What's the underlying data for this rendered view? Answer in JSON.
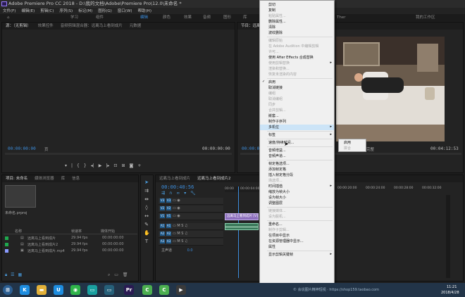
{
  "window": {
    "title": "Adobe Premiere Pro CC 2018 - D:\\我的文档\\Adobe\\Premiere Pro\\12.0\\未命名 *"
  },
  "menubar": [
    "文件(F)",
    "编辑(E)",
    "剪辑(C)",
    "序列(S)",
    "标记(M)",
    "图形(G)",
    "窗口(W)",
    "帮助(H)"
  ],
  "workspaces": {
    "items": [
      "学习",
      "组件",
      "编辑",
      "颜色",
      "效果",
      "音频",
      "图形",
      "库"
    ],
    "active": "编辑",
    "extra1": "Ther",
    "extra2": "我的工作区"
  },
  "source_panel": {
    "tabs": [
      "源：（无剪辑）",
      "效果控件",
      "音频剪辑混合器：远离马上看到成片",
      "元数据"
    ],
    "timecode_left": "00:00:00:00",
    "page_label": "页",
    "timecode_right": "00:00:00:00"
  },
  "program_panel": {
    "tab": "节目：远离马上看到成片",
    "timecode_left": "00:00:00:00",
    "fit_label": "完整",
    "timecode_right": "00:04:12:53"
  },
  "project_panel": {
    "tabs": [
      "项目: 未命名",
      "媒体浏览器",
      "库",
      "信息"
    ],
    "file_label": "未命名.prproj",
    "columns": [
      "名称",
      "帧速率",
      "媒体开始"
    ],
    "rows": [
      {
        "name": "远离马上看到成片",
        "fps": "29.94 fps",
        "start": "00:00:00:00",
        "color": "#1fa84e"
      },
      {
        "name": "远离马上看到成片2",
        "fps": "29.94 fps",
        "start": "00:00:00:00",
        "color": "#1fa84e"
      },
      {
        "name": "远离马上看到成片.mp4",
        "fps": "29.94 fps",
        "start": "00:00:00:00",
        "color": "#8a9bff"
      }
    ]
  },
  "timeline": {
    "tabs": [
      "远离马上看到成片",
      "远离马上看到成片2"
    ],
    "timecode": "00:00:40:56",
    "ruler": [
      "00:00",
      "00:00:04:00"
    ],
    "ruler_right": [
      "00:00:20:00",
      "00:00:24:00",
      "00:00:28:00",
      "00:00:32:00"
    ],
    "video_tracks": [
      "V3",
      "V2",
      "V1"
    ],
    "audio_tracks": [
      "A1",
      "A2",
      "A3"
    ],
    "master": "主声道",
    "master_value": "0.0",
    "clip_label": "远离马上看到成片 [V]"
  },
  "context_menu": {
    "items": [
      {
        "label": "剪切",
        "disabled": false
      },
      {
        "label": "复制",
        "disabled": false
      },
      {
        "label": "粘贴属性...",
        "disabled": true
      },
      {
        "label": "删除属性...",
        "disabled": false
      },
      {
        "label": "清除",
        "disabled": false
      },
      {
        "label": "波纹删除",
        "disabled": false
      },
      {
        "label": "",
        "sep": true
      },
      {
        "label": "编辑原始",
        "disabled": true
      },
      {
        "label": "在 Adobe Audition 中编辑剪辑",
        "disabled": true
      },
      {
        "label": "许可...",
        "disabled": true
      },
      {
        "label": "使用 After Effects 合成替换",
        "disabled": false
      },
      {
        "label": "使用剪辑替换",
        "disabled": true,
        "arrow": true
      },
      {
        "label": "渲染和替换...",
        "disabled": true
      },
      {
        "label": "恢复未渲染的内容",
        "disabled": true
      },
      {
        "label": "",
        "sep": true
      },
      {
        "label": "启用",
        "disabled": false,
        "checked": true
      },
      {
        "label": "取消链接",
        "disabled": false
      },
      {
        "label": "编组",
        "disabled": true
      },
      {
        "label": "取消编组",
        "disabled": true
      },
      {
        "label": "同步",
        "disabled": true
      },
      {
        "label": "合并剪辑...",
        "disabled": true
      },
      {
        "label": "嵌套...",
        "disabled": false
      },
      {
        "label": "制作子序列",
        "disabled": false
      },
      {
        "label": "多机位",
        "disabled": false,
        "arrow": true,
        "highlight": true
      },
      {
        "label": "",
        "sep": true
      },
      {
        "label": "标签",
        "disabled": false,
        "arrow": true
      },
      {
        "label": "",
        "sep": true
      },
      {
        "label": "速度/持续时间...",
        "disabled": false
      },
      {
        "label": "",
        "sep": true
      },
      {
        "label": "音频增益...",
        "disabled": false
      },
      {
        "label": "音频声道...",
        "disabled": false
      },
      {
        "label": "",
        "sep": true
      },
      {
        "label": "帧定格选项...",
        "disabled": false
      },
      {
        "label": "添加帧定格",
        "disabled": false
      },
      {
        "label": "插入帧定格分段",
        "disabled": false
      },
      {
        "label": "场选项...",
        "disabled": true
      },
      {
        "label": "时间插值",
        "disabled": false,
        "arrow": true
      },
      {
        "label": "缩放为帧大小",
        "disabled": false
      },
      {
        "label": "设为帧大小",
        "disabled": false
      },
      {
        "label": "调整图层",
        "disabled": false
      },
      {
        "label": "",
        "sep": true
      },
      {
        "label": "链接媒体...",
        "disabled": true
      },
      {
        "label": "设为脱机...",
        "disabled": true
      },
      {
        "label": "",
        "sep": true
      },
      {
        "label": "重命名...",
        "disabled": false
      },
      {
        "label": "制作子剪辑...",
        "disabled": true
      },
      {
        "label": "在项目中显示",
        "disabled": false
      },
      {
        "label": "在资源管理器中显示...",
        "disabled": false
      },
      {
        "label": "属性",
        "disabled": false
      },
      {
        "label": "",
        "sep": true
      },
      {
        "label": "显示剪辑关键帧",
        "disabled": false,
        "arrow": true
      }
    ],
    "submenu": [
      {
        "label": "启用",
        "disabled": false
      },
      {
        "label": "拼合",
        "disabled": true
      }
    ]
  },
  "taskbar": {
    "icons": [
      {
        "name": "start-icon",
        "glyph": "⊞",
        "color": "#2b5e92"
      },
      {
        "name": "k-app-icon",
        "glyph": "K",
        "color": "#1d8de0"
      },
      {
        "name": "explorer-icon",
        "glyph": "▬",
        "color": "#e2b13a"
      },
      {
        "name": "u-app-icon",
        "glyph": "U",
        "color": "#1d8de0"
      },
      {
        "name": "wechat-icon",
        "glyph": "◉",
        "color": "#2fb44a"
      },
      {
        "name": "chat-icon",
        "glyph": "▭",
        "color": "#1aa0a0"
      },
      {
        "name": "monitor-icon",
        "glyph": "▭",
        "color": "#26607a"
      },
      {
        "name": "premiere-icon",
        "glyph": "Pr",
        "color": "#2a1b53"
      },
      {
        "name": "c-app-icon",
        "glyph": "C",
        "color": "#4caf50"
      },
      {
        "name": "c-app2-icon",
        "glyph": "C",
        "color": "#4caf50"
      },
      {
        "name": "video-icon",
        "glyph": "▶",
        "color": "#3a3a3a"
      }
    ],
    "watermark": "© 会说图片精神短视 · https://shop159.taobao.com",
    "time": "11:21",
    "date": "2018/4/28"
  }
}
